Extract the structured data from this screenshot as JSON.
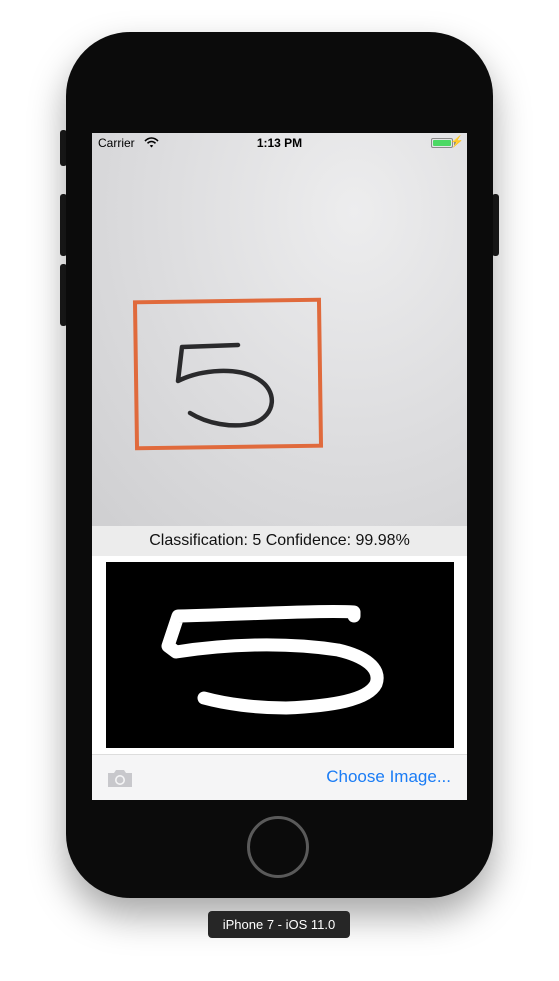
{
  "status_bar": {
    "carrier": "Carrier",
    "time": "1:13 PM",
    "battery_color": "#4cd964"
  },
  "photo": {
    "handwritten_digit": "5",
    "box_color": "#e06a3c"
  },
  "result": {
    "text": "Classification: 5 Confidence: 99.98%"
  },
  "processed_image": {
    "digit": "5"
  },
  "toolbar": {
    "camera_icon": "camera-icon",
    "choose_label": "Choose Image...",
    "accent": "#1a7cf5"
  },
  "device": {
    "label": "iPhone 7 - iOS 11.0"
  }
}
